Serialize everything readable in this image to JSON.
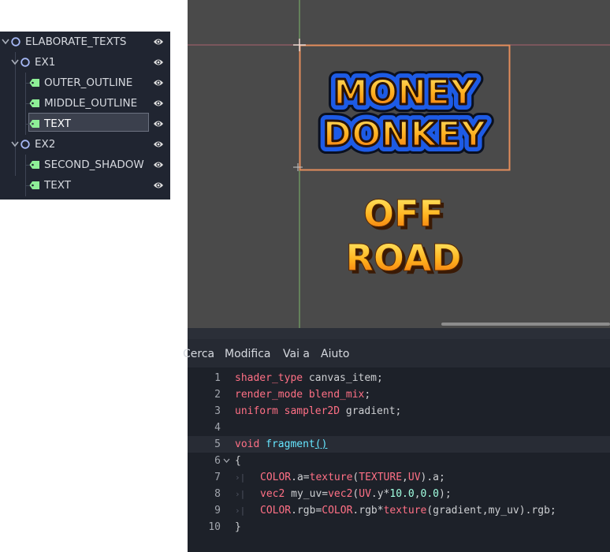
{
  "scene_tree": {
    "items": [
      {
        "label": "ELABORATE_TEXTS",
        "type": "node2d",
        "expanded": true
      },
      {
        "label": "EX1",
        "type": "node2d",
        "expanded": true
      },
      {
        "label": "OUTER_OUTLINE",
        "type": "label"
      },
      {
        "label": "MIDDLE_OUTLINE",
        "type": "label"
      },
      {
        "label": "TEXT",
        "type": "label",
        "selected": true
      },
      {
        "label": "EX2",
        "type": "node2d",
        "expanded": true
      },
      {
        "label": "SECOND_SHADOW",
        "type": "label"
      },
      {
        "label": "TEXT",
        "type": "label"
      }
    ]
  },
  "viewport": {
    "text1_line1": "MONEY",
    "text1_line2": "DONKEY",
    "text2_line1": "OFF",
    "text2_line2": "ROAD"
  },
  "menu": {
    "items": [
      "Cerca",
      "Modifica",
      "Vai a",
      "Aiuto"
    ]
  },
  "editor": {
    "line_numbers": [
      "1",
      "2",
      "3",
      "4",
      "5",
      "6",
      "7",
      "8",
      "9",
      "10"
    ]
  },
  "colors": {
    "panel_bg": "#202531",
    "viewport_bg": "#4a4a4a",
    "editor_bg": "#1d2129",
    "keyword": "#ff7085",
    "function": "#66e6ff",
    "number": "#a1ffe0",
    "selection_rect": "#e48d5c"
  }
}
